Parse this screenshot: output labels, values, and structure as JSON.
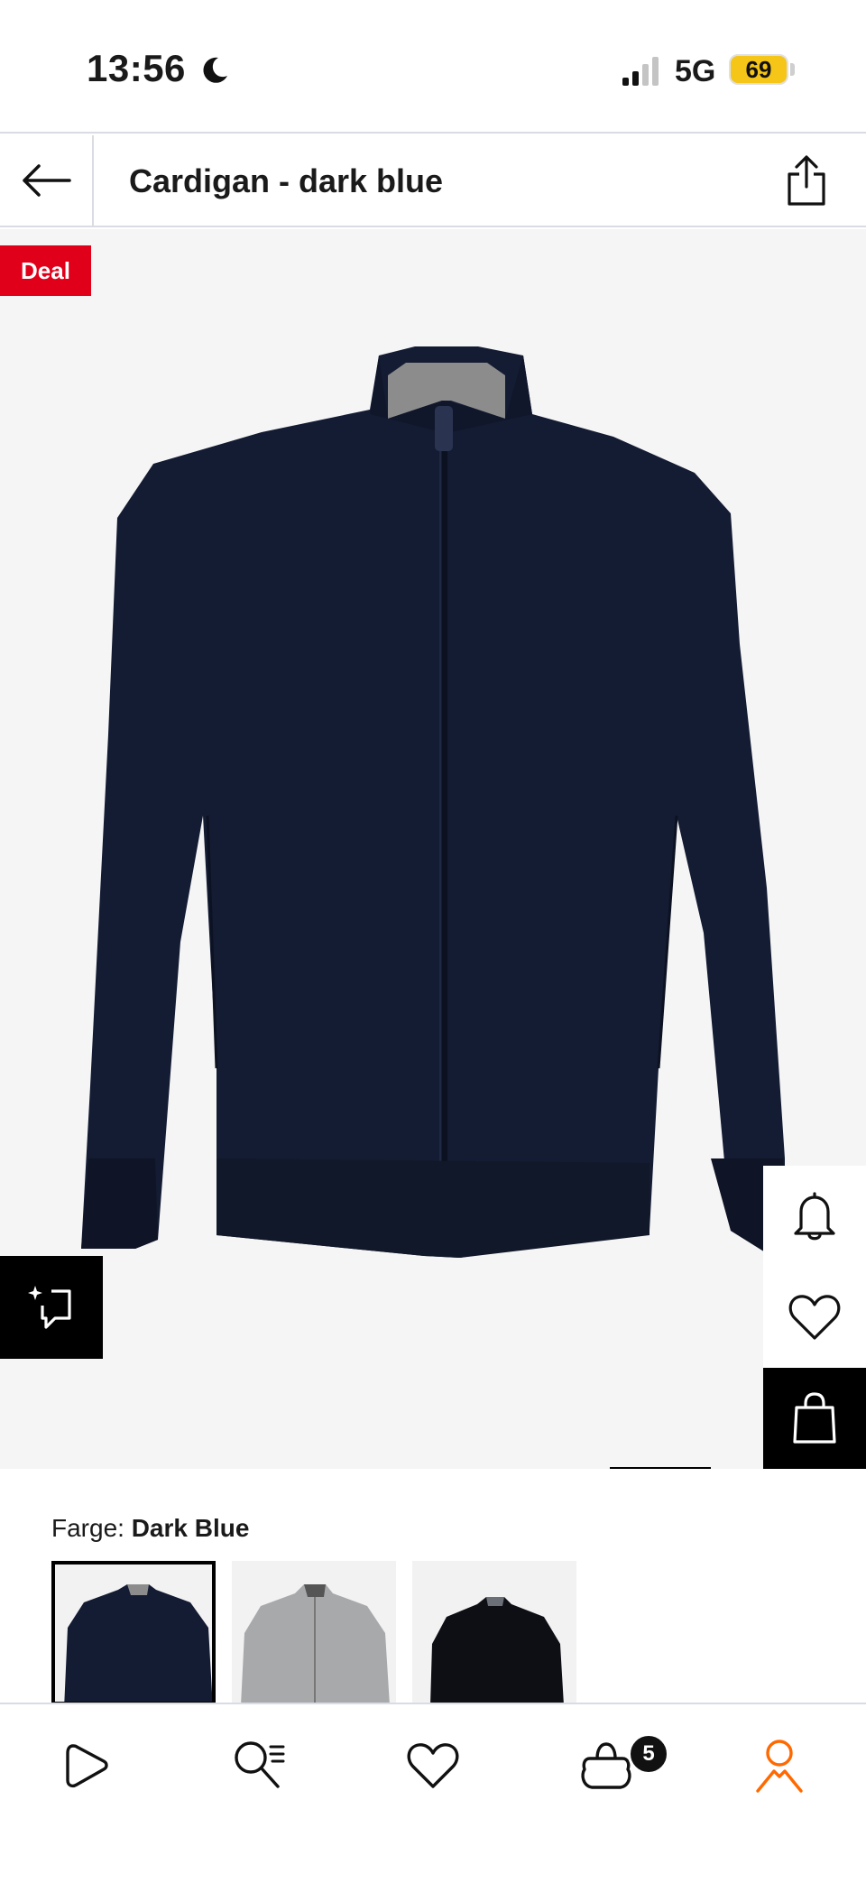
{
  "status_bar": {
    "time": "13:56",
    "network": "5G",
    "battery": "69",
    "icons": [
      "moon-icon",
      "signal-icon",
      "battery-icon"
    ]
  },
  "header": {
    "title": "Cardigan - dark blue",
    "icons": [
      "back-arrow-icon",
      "share-icon"
    ]
  },
  "gallery": {
    "badge": "Deal",
    "icons": [
      "similar-items-icon",
      "bell-icon",
      "heart-icon",
      "bag-icon"
    ]
  },
  "color_selector": {
    "label": "Farge: ",
    "selected": "Dark Blue",
    "options": [
      "dark-blue",
      "grey",
      "black"
    ]
  },
  "bottom_nav": {
    "items": [
      "home-icon",
      "search-icon",
      "wishlist-icon",
      "cart-icon",
      "profile-icon"
    ],
    "cart_count": "5",
    "accent": "#ff6900"
  },
  "colors": {
    "deal_red": "#e0001a",
    "product_navy": "#141c33",
    "background": "#f5f5f6"
  }
}
